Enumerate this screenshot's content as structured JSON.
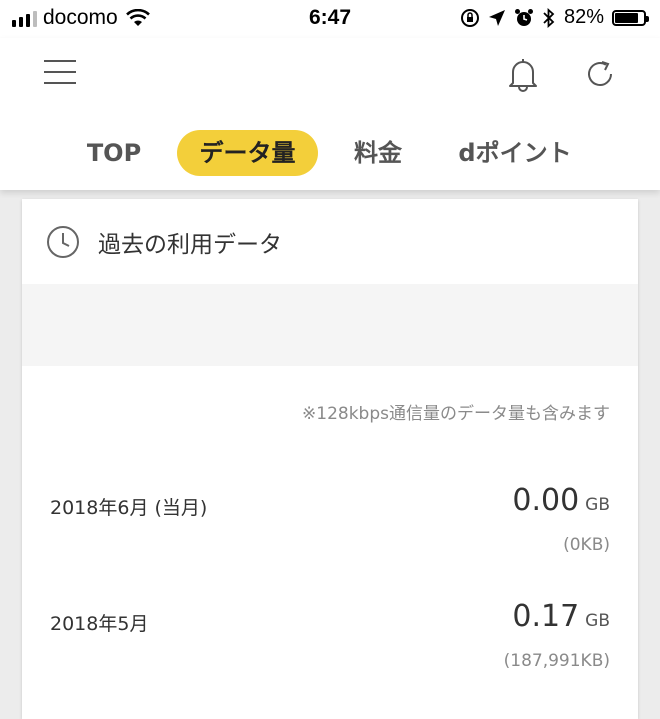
{
  "status_bar": {
    "carrier": "docomo",
    "time": "6:47",
    "battery_percent": "82%",
    "battery_level": 0.82
  },
  "header": {
    "tabs": [
      {
        "label": "TOP",
        "active": false
      },
      {
        "label": "データ量",
        "active": true
      },
      {
        "label": "料金",
        "active": false
      },
      {
        "label": "dポイント",
        "active": false
      }
    ]
  },
  "card": {
    "title": "過去の利用データ",
    "note": "※128kbps通信量のデータ量も含みます",
    "rows": [
      {
        "label": "2018年6月 (当月)",
        "value": "0.00",
        "unit": "GB",
        "sub": "(0KB)"
      },
      {
        "label": "2018年5月",
        "value": "0.17",
        "unit": "GB",
        "sub": "(187,991KB)"
      }
    ]
  },
  "colors": {
    "accent": "#f3cf3a",
    "background": "#ececec"
  }
}
